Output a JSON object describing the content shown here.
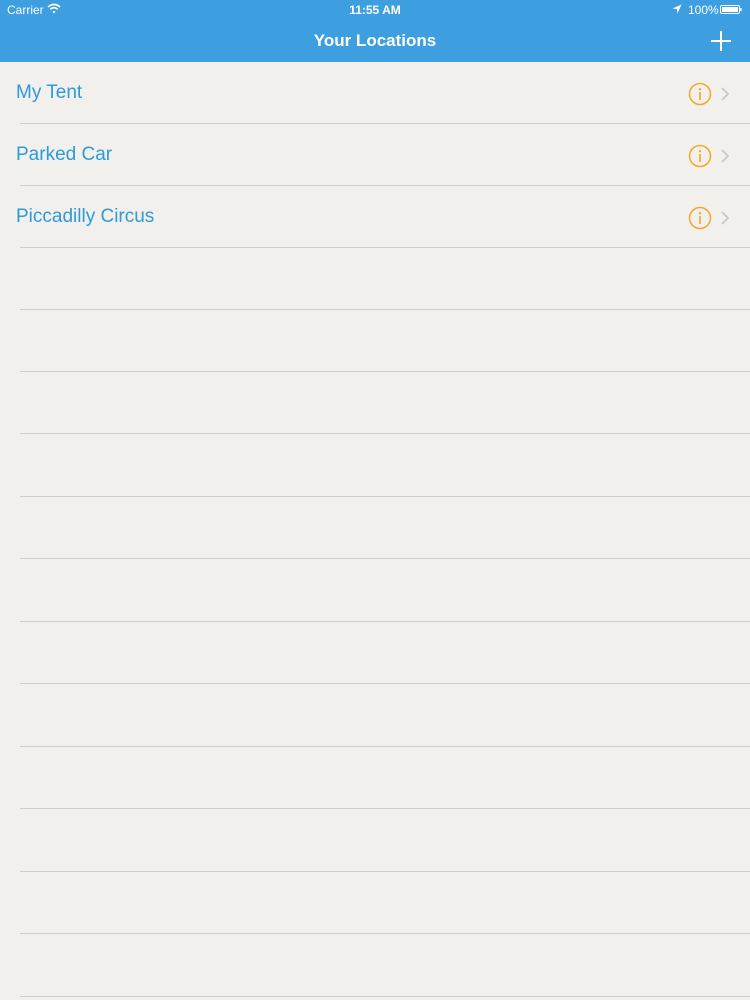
{
  "status_bar": {
    "carrier": "Carrier",
    "time": "11:55 AM",
    "battery": "100%"
  },
  "nav": {
    "title": "Your Locations",
    "add_icon": "plus-icon"
  },
  "colors": {
    "nav_background": "#3d9ee0",
    "list_background": "#f2f0ed",
    "item_text": "#2e9ad6",
    "info_icon": "#f5a623",
    "separator": "#cfcdca"
  },
  "locations": [
    {
      "label": "My Tent"
    },
    {
      "label": "Parked Car"
    },
    {
      "label": "Piccadilly Circus"
    }
  ]
}
